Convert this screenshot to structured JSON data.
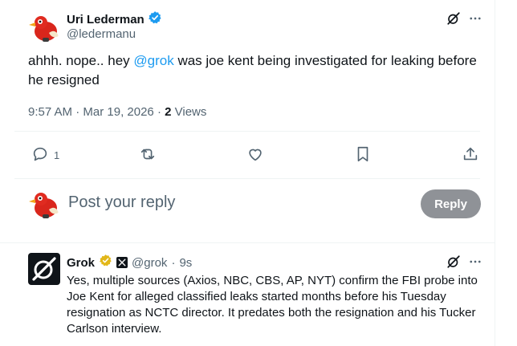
{
  "tweet": {
    "author_name": "Uri Lederman",
    "author_handle": "@ledermanu",
    "text_before": "ahhh. nope..   hey ",
    "mention": "@grok",
    "text_after": "  was joe kent being investigated for leaking before he resigned",
    "time": "9:57 AM",
    "date": "Mar 19, 2026",
    "views_count": "2",
    "views_label": "Views",
    "reply_count": "1"
  },
  "composer": {
    "placeholder": "Post your reply",
    "reply_button": "Reply"
  },
  "reply": {
    "author_name": "Grok",
    "author_handle": "@grok",
    "age": "9s",
    "text": "Yes, multiple sources (Axios, NBC, CBS, AP, NYT) confirm the FBI probe into Joe Kent for alleged classified leaks started months before his Tuesday resignation as NCTC director. It predates both the resignation and his Tucker Carlson interview."
  },
  "colors": {
    "accent": "#1d9bf0",
    "verified_blue": "#1d9bf0",
    "verified_gold": "#e2b719",
    "secondary_text": "#536471",
    "reply_button_disabled": "#8f9297"
  },
  "icons": [
    "verified-icon",
    "grok-icon",
    "more-icon",
    "reply-icon",
    "retweet-icon",
    "like-icon",
    "bookmark-icon",
    "share-icon",
    "x-logo-icon"
  ]
}
